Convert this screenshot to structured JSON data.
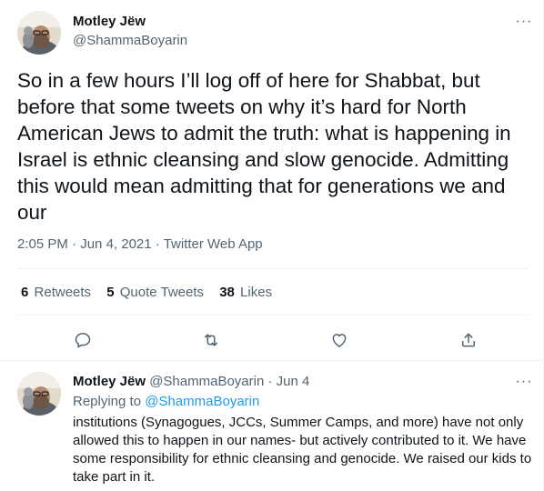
{
  "tweet": {
    "author_name": "Motley Jëw",
    "author_handle": "@ShammaBoyarin",
    "text": "So in a few hours I’ll log off of here for Shabbat, but before that some tweets on why it’s hard for North American Jews to admit the truth: what is happening in Israel is ethnic cleansing and slow genocide. Admitting this would mean admitting that for generations we and our",
    "time": "2:05 PM",
    "date": "Jun 4, 2021",
    "source": "Twitter Web App",
    "more_icon": "···"
  },
  "stats": {
    "retweets_count": "6",
    "retweets_label": "Retweets",
    "quotes_count": "5",
    "quotes_label": "Quote Tweets",
    "likes_count": "38",
    "likes_label": "Likes"
  },
  "actions": [
    "reply-icon",
    "retweet-icon",
    "like-icon",
    "share-icon"
  ],
  "reply": {
    "author_name": "Motley Jëw",
    "author_handle": "@ShammaBoyarin",
    "dot": "·",
    "date": "Jun 4",
    "replying_prefix": "Replying to",
    "replying_to": "@ShammaBoyarin",
    "text": "institutions (Synagogues, JCCs, Summer Camps, and more) have not only allowed this to happen in our names- but actively contributed to it. We have some responsibility for ethnic cleansing and genocide. We raised our kids to take part in it.",
    "more_icon": "···"
  },
  "colors": {
    "accent": "#1d9bf0",
    "muted": "#536471",
    "text": "#0f1419",
    "divider": "#eff3f4"
  }
}
